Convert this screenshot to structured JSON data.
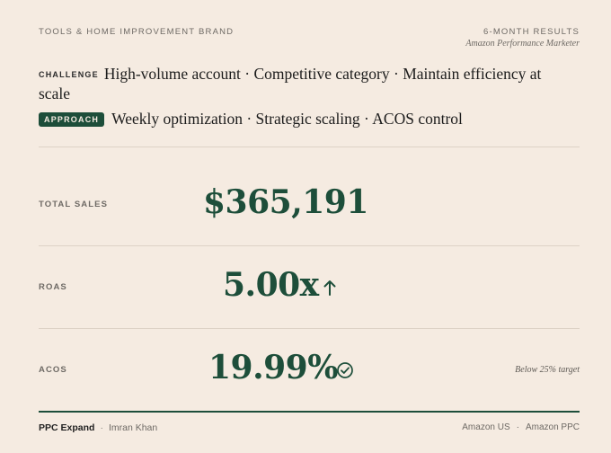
{
  "header": {
    "brand": "TOOLS & HOME IMPROVEMENT BRAND",
    "results": "6-MONTH RESULTS",
    "role": "Amazon Performance Marketer"
  },
  "challenge": {
    "tag": "CHALLENGE",
    "text": "High-volume account · Competitive category · Maintain efficiency at scale"
  },
  "approach": {
    "tag": "APPROACH",
    "text": "Weekly optimization · Strategic scaling · ACOS control"
  },
  "metrics": [
    {
      "label": "TOTAL SALES",
      "value": "$365,191",
      "icon": "",
      "note": ""
    },
    {
      "label": "ROAS",
      "value": "5.00x",
      "icon": "arrow-up-icon",
      "note": ""
    },
    {
      "label": "ACOS",
      "value": "19.99%",
      "icon": "check-circle-icon",
      "note": "Below 25% target"
    }
  ],
  "footer": {
    "company": "PPC Expand",
    "separator": "·",
    "person": "Imran Khan",
    "marketplace": "Amazon US",
    "service": "Amazon PPC"
  },
  "colors": {
    "background": "#f5ebe1",
    "accent": "#1d4e3a",
    "muted": "#6e6a65"
  }
}
